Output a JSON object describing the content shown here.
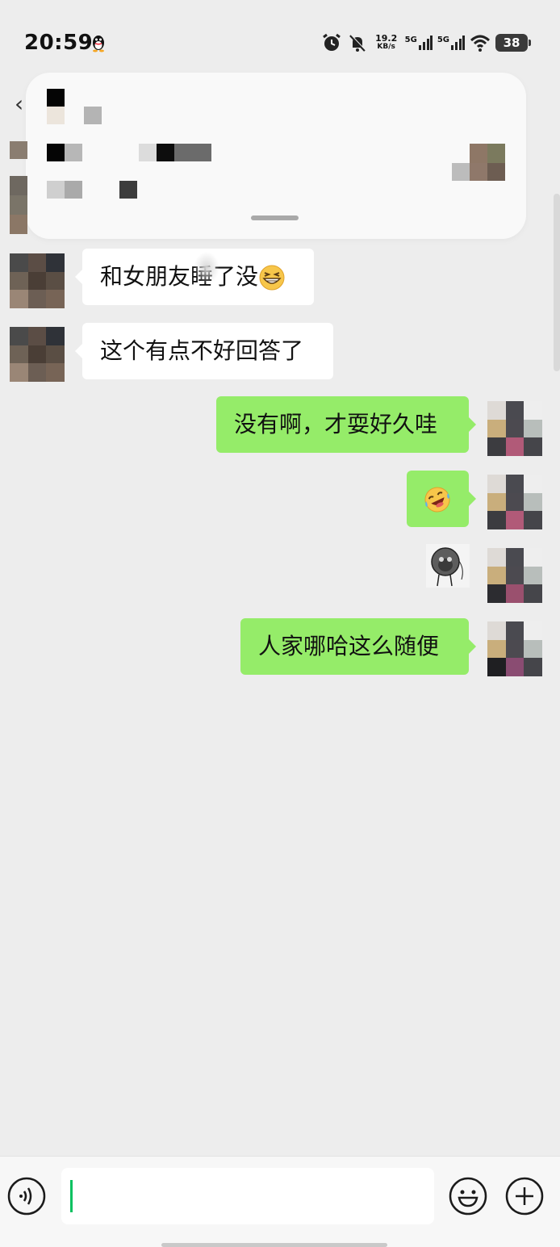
{
  "status_bar": {
    "time": "20:59",
    "net_speed_value": "19.2",
    "net_speed_unit": "KB/s",
    "sim1": "5G",
    "sim2": "5G",
    "battery": "38"
  },
  "chat": {
    "messages": [
      {
        "side": "in",
        "text": "和女朋友睡了没",
        "emoji": "grinning-squint-face"
      },
      {
        "side": "in",
        "text": "这个有点不好回答了"
      },
      {
        "side": "out",
        "text": "没有啊，才耍好久哇"
      },
      {
        "side": "out",
        "emoji": "rofl-face"
      },
      {
        "side": "out",
        "sticker": "monkey-sticker"
      },
      {
        "side": "out",
        "text": "人家哪哈这么随便"
      }
    ]
  },
  "input_bar": {
    "value": ""
  },
  "colors": {
    "background": "#ededed",
    "bubble_in": "#ffffff",
    "bubble_out": "#95ec69",
    "caret": "#07c160"
  }
}
